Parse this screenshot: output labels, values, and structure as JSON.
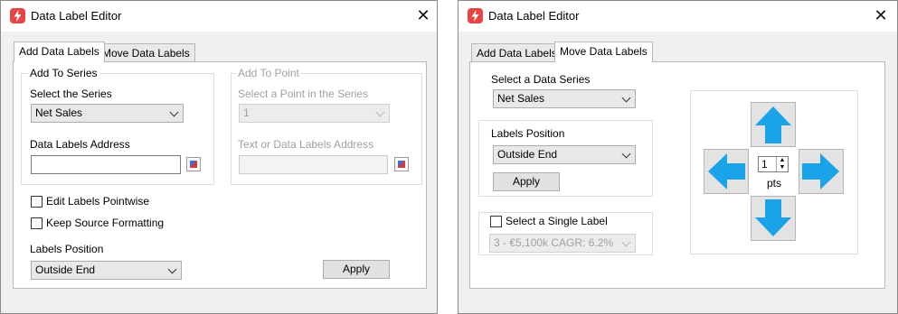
{
  "colors": {
    "accent_red": "#e84545",
    "arrow_blue": "#1aa3e8"
  },
  "left_window": {
    "title": "Data Label Editor",
    "tabs": [
      {
        "label": "Add Data Labels",
        "active": true
      },
      {
        "label": "Move Data Labels",
        "active": false
      }
    ],
    "add_to_series": {
      "legend": "Add To Series",
      "select_series_label": "Select the Series",
      "series_value": "Net Sales",
      "address_label": "Data Labels Address",
      "address_value": ""
    },
    "add_to_point": {
      "legend": "Add To Point",
      "select_point_label": "Select a Point in the Series",
      "point_value": "1",
      "address_label": "Text or Data Labels Address",
      "address_value": ""
    },
    "edit_pointwise_label": "Edit Labels Pointwise",
    "edit_pointwise_checked": false,
    "keep_formatting_label": "Keep Source Formatting",
    "keep_formatting_checked": false,
    "labels_position_label": "Labels Position",
    "labels_position_value": "Outside End",
    "apply_label": "Apply"
  },
  "right_window": {
    "title": "Data Label Editor",
    "tabs": [
      {
        "label": "Add Data Labels",
        "active": false
      },
      {
        "label": "Move Data Labels",
        "active": true
      }
    ],
    "select_series_label": "Select a Data Series",
    "series_value": "Net Sales",
    "labels_position_label": "Labels Position",
    "labels_position_value": "Outside End",
    "apply_label": "Apply",
    "single_label_label": "Select a Single Label",
    "single_label_checked": false,
    "single_label_value": "3 - €5,100k  CAGR: 6.2%",
    "move_step_value": "1",
    "move_unit": "pts"
  }
}
